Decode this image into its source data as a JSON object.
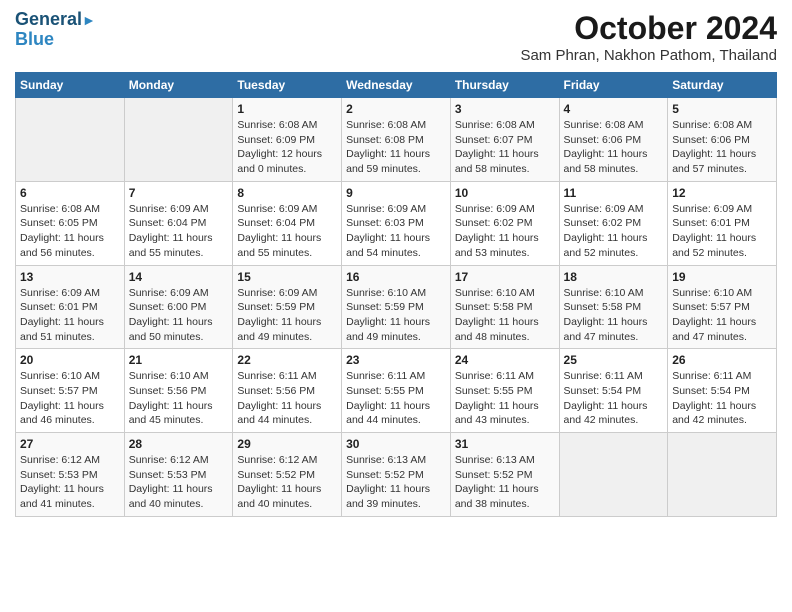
{
  "header": {
    "logo_line1": "General",
    "logo_line2": "Blue",
    "title": "October 2024",
    "subtitle": "Sam Phran, Nakhon Pathom, Thailand"
  },
  "days_of_week": [
    "Sunday",
    "Monday",
    "Tuesday",
    "Wednesday",
    "Thursday",
    "Friday",
    "Saturday"
  ],
  "weeks": [
    [
      {
        "day": "",
        "info": ""
      },
      {
        "day": "",
        "info": ""
      },
      {
        "day": "1",
        "info": "Sunrise: 6:08 AM\nSunset: 6:09 PM\nDaylight: 12 hours\nand 0 minutes."
      },
      {
        "day": "2",
        "info": "Sunrise: 6:08 AM\nSunset: 6:08 PM\nDaylight: 11 hours\nand 59 minutes."
      },
      {
        "day": "3",
        "info": "Sunrise: 6:08 AM\nSunset: 6:07 PM\nDaylight: 11 hours\nand 58 minutes."
      },
      {
        "day": "4",
        "info": "Sunrise: 6:08 AM\nSunset: 6:06 PM\nDaylight: 11 hours\nand 58 minutes."
      },
      {
        "day": "5",
        "info": "Sunrise: 6:08 AM\nSunset: 6:06 PM\nDaylight: 11 hours\nand 57 minutes."
      }
    ],
    [
      {
        "day": "6",
        "info": "Sunrise: 6:08 AM\nSunset: 6:05 PM\nDaylight: 11 hours\nand 56 minutes."
      },
      {
        "day": "7",
        "info": "Sunrise: 6:09 AM\nSunset: 6:04 PM\nDaylight: 11 hours\nand 55 minutes."
      },
      {
        "day": "8",
        "info": "Sunrise: 6:09 AM\nSunset: 6:04 PM\nDaylight: 11 hours\nand 55 minutes."
      },
      {
        "day": "9",
        "info": "Sunrise: 6:09 AM\nSunset: 6:03 PM\nDaylight: 11 hours\nand 54 minutes."
      },
      {
        "day": "10",
        "info": "Sunrise: 6:09 AM\nSunset: 6:02 PM\nDaylight: 11 hours\nand 53 minutes."
      },
      {
        "day": "11",
        "info": "Sunrise: 6:09 AM\nSunset: 6:02 PM\nDaylight: 11 hours\nand 52 minutes."
      },
      {
        "day": "12",
        "info": "Sunrise: 6:09 AM\nSunset: 6:01 PM\nDaylight: 11 hours\nand 52 minutes."
      }
    ],
    [
      {
        "day": "13",
        "info": "Sunrise: 6:09 AM\nSunset: 6:01 PM\nDaylight: 11 hours\nand 51 minutes."
      },
      {
        "day": "14",
        "info": "Sunrise: 6:09 AM\nSunset: 6:00 PM\nDaylight: 11 hours\nand 50 minutes."
      },
      {
        "day": "15",
        "info": "Sunrise: 6:09 AM\nSunset: 5:59 PM\nDaylight: 11 hours\nand 49 minutes."
      },
      {
        "day": "16",
        "info": "Sunrise: 6:10 AM\nSunset: 5:59 PM\nDaylight: 11 hours\nand 49 minutes."
      },
      {
        "day": "17",
        "info": "Sunrise: 6:10 AM\nSunset: 5:58 PM\nDaylight: 11 hours\nand 48 minutes."
      },
      {
        "day": "18",
        "info": "Sunrise: 6:10 AM\nSunset: 5:58 PM\nDaylight: 11 hours\nand 47 minutes."
      },
      {
        "day": "19",
        "info": "Sunrise: 6:10 AM\nSunset: 5:57 PM\nDaylight: 11 hours\nand 47 minutes."
      }
    ],
    [
      {
        "day": "20",
        "info": "Sunrise: 6:10 AM\nSunset: 5:57 PM\nDaylight: 11 hours\nand 46 minutes."
      },
      {
        "day": "21",
        "info": "Sunrise: 6:10 AM\nSunset: 5:56 PM\nDaylight: 11 hours\nand 45 minutes."
      },
      {
        "day": "22",
        "info": "Sunrise: 6:11 AM\nSunset: 5:56 PM\nDaylight: 11 hours\nand 44 minutes."
      },
      {
        "day": "23",
        "info": "Sunrise: 6:11 AM\nSunset: 5:55 PM\nDaylight: 11 hours\nand 44 minutes."
      },
      {
        "day": "24",
        "info": "Sunrise: 6:11 AM\nSunset: 5:55 PM\nDaylight: 11 hours\nand 43 minutes."
      },
      {
        "day": "25",
        "info": "Sunrise: 6:11 AM\nSunset: 5:54 PM\nDaylight: 11 hours\nand 42 minutes."
      },
      {
        "day": "26",
        "info": "Sunrise: 6:11 AM\nSunset: 5:54 PM\nDaylight: 11 hours\nand 42 minutes."
      }
    ],
    [
      {
        "day": "27",
        "info": "Sunrise: 6:12 AM\nSunset: 5:53 PM\nDaylight: 11 hours\nand 41 minutes."
      },
      {
        "day": "28",
        "info": "Sunrise: 6:12 AM\nSunset: 5:53 PM\nDaylight: 11 hours\nand 40 minutes."
      },
      {
        "day": "29",
        "info": "Sunrise: 6:12 AM\nSunset: 5:52 PM\nDaylight: 11 hours\nand 40 minutes."
      },
      {
        "day": "30",
        "info": "Sunrise: 6:13 AM\nSunset: 5:52 PM\nDaylight: 11 hours\nand 39 minutes."
      },
      {
        "day": "31",
        "info": "Sunrise: 6:13 AM\nSunset: 5:52 PM\nDaylight: 11 hours\nand 38 minutes."
      },
      {
        "day": "",
        "info": ""
      },
      {
        "day": "",
        "info": ""
      }
    ]
  ]
}
